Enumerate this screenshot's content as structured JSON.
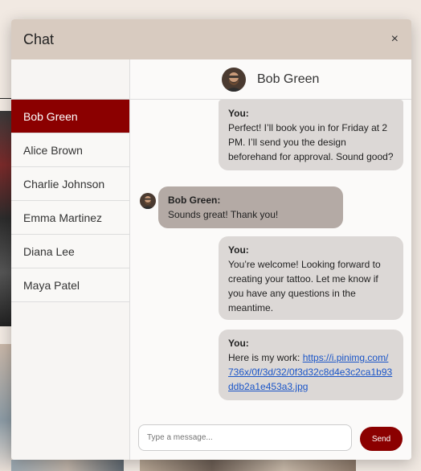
{
  "modal": {
    "title": "Chat",
    "close_label": "×"
  },
  "contacts": [
    {
      "name": "Bob Green",
      "active": true
    },
    {
      "name": "Alice Brown"
    },
    {
      "name": "Charlie Johnson"
    },
    {
      "name": "Emma Martinez"
    },
    {
      "name": "Diana Lee"
    },
    {
      "name": "Maya Patel"
    }
  ],
  "chat": {
    "header_name": "Bob Green",
    "messages": [
      {
        "from": "you",
        "sender": "You:",
        "text": "Perfect! I’ll book you in for Friday at 2 PM. I’ll send you the design beforehand for approval. Sound good?"
      },
      {
        "from": "other",
        "sender": "Bob Green:",
        "text": "Sounds great! Thank you!"
      },
      {
        "from": "you",
        "sender": "You:",
        "text": "You’re welcome! Looking forward to creating your tattoo. Let me know if you have any questions in the meantime."
      },
      {
        "from": "you",
        "sender": "You:",
        "text": "Here is my work: ",
        "link": "https://i.pinimg.com/736x/0f/3d/32/0f3d32c8d4e3c2ca1b93ddb2a1e453a3.jpg"
      }
    ]
  },
  "composer": {
    "placeholder": "Type a message...",
    "send_label": "Send"
  },
  "colors": {
    "accent": "#8b0000",
    "header_bg": "#d8cbc0",
    "bubble_you": "#dcd8d6",
    "bubble_other": "#b4aaa5"
  }
}
